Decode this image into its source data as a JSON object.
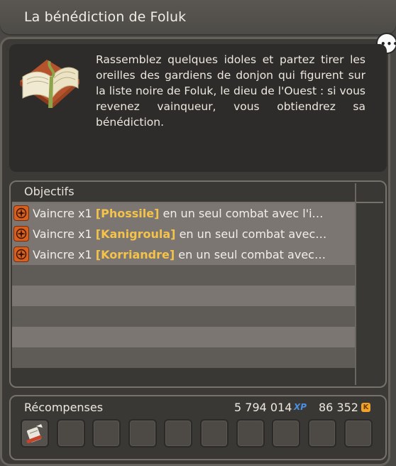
{
  "window": {
    "title": "La bénédiction de Foluk"
  },
  "quest": {
    "icon": "open-book-icon",
    "description": "Rassemblez quelques idoles et partez tirer les oreilles des gardiens de donjon qui figurent sur la liste noire de Foluk, le dieu de l'Ouest : si vous revenez vainqueur, vous obtiendrez sa bénédiction."
  },
  "objectives": {
    "header": "Objectifs",
    "items": [
      {
        "prefix": "Vaincre x1 ",
        "target": "[Phossile]",
        "suffix": " en un seul combat avec l'i…",
        "icon": "compass-icon"
      },
      {
        "prefix": "Vaincre x1 ",
        "target": "[Kanigroula]",
        "suffix": " en un seul combat avec…",
        "icon": "compass-icon"
      },
      {
        "prefix": "Vaincre x1 ",
        "target": "[Korriandre]",
        "suffix": " en un seul combat avec…",
        "icon": "compass-icon"
      }
    ]
  },
  "rewards": {
    "label": "Récompenses",
    "xp": "5 794 014",
    "xp_icon_text": "XP",
    "kamas": "86 352",
    "kamas_icon_text": "K",
    "slots": [
      {
        "filled": true,
        "icon": "scroll-icon"
      },
      {
        "filled": false
      },
      {
        "filled": false
      },
      {
        "filled": false
      },
      {
        "filled": false
      },
      {
        "filled": false
      },
      {
        "filled": false
      },
      {
        "filled": false
      },
      {
        "filled": false
      },
      {
        "filled": false
      }
    ]
  },
  "colors": {
    "highlight": "#f5c34a",
    "xp": "#4a8fe0",
    "kamas": "#f0a52a",
    "objective_icon": "#d5601f"
  }
}
